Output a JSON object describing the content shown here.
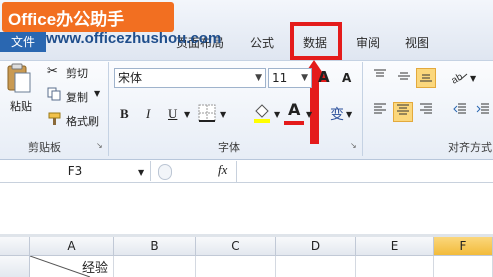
{
  "watermark": {
    "logo_text": "Office办公助手",
    "url_text": "www.officezhushou.com"
  },
  "tabs": {
    "file": "文件",
    "page_layout": "页面布局",
    "formulas": "公式",
    "data": "数据",
    "review": "审阅",
    "view": "视图"
  },
  "clipboard": {
    "paste": "粘贴",
    "cut": "剪切",
    "copy": "复制",
    "format_painter": "格式刷",
    "group_label": "剪贴板"
  },
  "font": {
    "font_name": "宋体",
    "font_size": "11",
    "bold": "B",
    "italic": "I",
    "underline": "U",
    "grow": "A",
    "shrink": "A",
    "font_color_letter": "A",
    "phonetic": "变",
    "group_label": "字体"
  },
  "alignment": {
    "group_label": "对齐方式"
  },
  "formula_bar": {
    "name_box": "F3",
    "fx": "fx",
    "formula": ""
  },
  "sheet": {
    "columns": [
      "A",
      "B",
      "C",
      "D",
      "E",
      "F"
    ],
    "selected_column": "F",
    "row1_a1": "经验"
  },
  "colors": {
    "highlight": "#e41b1b",
    "file_tab": "#2a67b1",
    "logo_bg": "#f26f21",
    "selected_column": "#f9c94f"
  }
}
